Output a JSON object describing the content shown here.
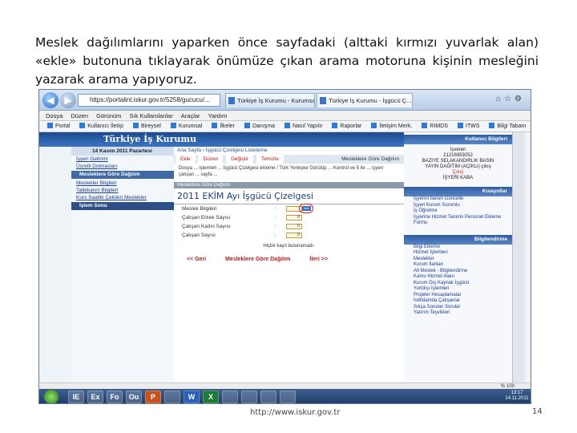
{
  "slide": {
    "caption": "Meslek dağılımlarını yaparken önce sayfadaki (alttaki kırmızı yuvarlak alan) «ekle» butonuna tıklayarak önümüze çıkan arama motoruna kişinin mesleğini yazarak arama yapıyoruz.",
    "footer_url": "http://www.iskur.gov.tr",
    "page_number": "14"
  },
  "browser": {
    "url": "https://portalint.iskur.gov.tr/5258/gucucu/...",
    "tabs": [
      "Türkiye İş Kurumu - Kurumsal",
      "Türkiye İş Kurumu - İşgücü Ç..."
    ],
    "menu": [
      "Dosya",
      "Düzen",
      "Görünüm",
      "Sık Kullanılanlar",
      "Araçlar",
      "Yardım"
    ],
    "favorites": [
      "Portal",
      "Kullanıcı İletişi",
      "Bireysel",
      "Kurumsal",
      "İlkeler",
      "Danışma",
      "Nasıl Yapılır",
      "Raporlar",
      "İletişim Merk.",
      "RIMDS",
      "ITWS",
      "Bilgi Tabanı"
    ],
    "zoom": "% 100"
  },
  "site": {
    "banner_title": "Türkiye İş Kurumu",
    "date": "14 Kasım 2011 Pazartesi",
    "left_links": [
      "İşyeri Getirimi",
      "Ücretli Dolmasları"
    ],
    "left_active": "Mesleklere Göre Dağılım",
    "left_sub": [
      "Meslekler Bilgileri",
      "Tatbikatım Bilgileri",
      "Kurs Saatlik Çekilen Meslekler"
    ],
    "left_exit": "İşlem Sonu",
    "breadcrumb": "Ana Sayfa › İşgücü Çizelgesi Listeleme",
    "tabs": [
      "Ekle",
      "Düzen",
      "Değiştir",
      "Temizle"
    ],
    "tabs_right": "Mesleklere Göre Dağılım",
    "message": "Dosya ... işlemleri ... İşgücü Çizelgesi ekleme / Türk Yerleşke Görülüp ... Kontrol ve 5 ile ... işyeri çalışan ... sayfa ...",
    "section_header": "Mesleklere Göre Dağılım",
    "table_title": "2011 EKİM Ayı İşgücü Çizelgesi",
    "fields": [
      {
        "label": "Meslek Bilgileri",
        "value": ""
      },
      {
        "label": "Çalışan Erkek Sayısı",
        "value": "0"
      },
      {
        "label": "Çalışan Kadın Sayısı",
        "value": "0"
      },
      {
        "label": "Çalışan Sayısı",
        "value": "0"
      }
    ],
    "ekle_label": "ekle",
    "no_data": "Hiçbir kayıt bulunamadı.",
    "bottom_nav": [
      "<< Geri",
      "Mesleklere Göre Dağılım",
      "İleri >>"
    ]
  },
  "right": {
    "user_header": "Kullanıcı Bilgileri",
    "user_lines": [
      "İşveren",
      "21216959252",
      "BAZIYE SELAKANDIRLIK BASIN",
      "YAYIN DAĞITIM (AÇIKLI) çıkış"
    ],
    "user_red": "Çıkış",
    "user_tail": "İŞYERİ KABA",
    "links_header": "Kısayollar",
    "links": [
      "İşyerini İlanen Güncelle",
      "İşyeri Kurum Sorumlu",
      "İş Öğretme",
      "İşyerine Hizmet Tanımlı Personel Ekleme Formu"
    ],
    "info_header": "Bilgilendirme",
    "info_links": [
      "Bilgi Ekleme",
      "Hizmet İşlemleri",
      "Meslekler",
      "Kurum İlanları",
      "Alt Meslek - Bilgilendirme",
      "Kamu Hizmet Alanı",
      "Kurum Dış Kaynak İşgücü",
      "Yurtdışı İşlemleri",
      "Projeler Hesaplamalar",
      "İstihdamda Çalışanlar",
      "Sıkça Sorulan Sorular",
      "Yatırım Teşvikleri"
    ]
  },
  "taskbar": {
    "apps": [
      "IE",
      "Ex",
      "Fo",
      "Ou",
      "P",
      "",
      "W",
      "X",
      "",
      "",
      "",
      ""
    ],
    "time": "13:17",
    "date": "14.11.2011"
  }
}
